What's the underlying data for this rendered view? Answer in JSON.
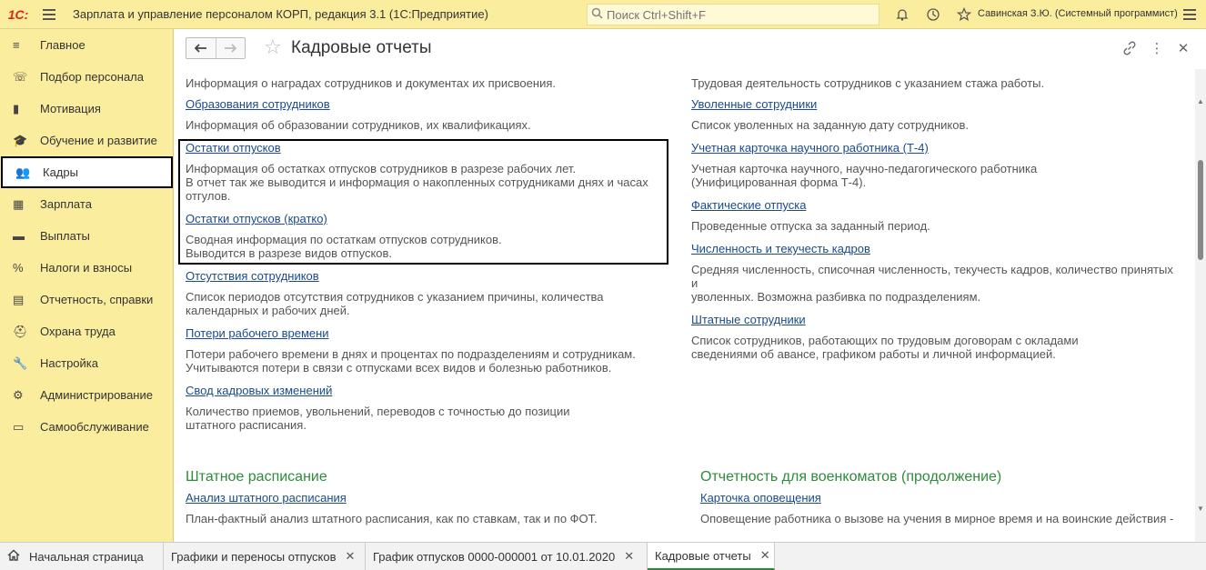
{
  "app": {
    "logo_text": "1С:",
    "title": "Зарплата и управление персоналом КОРП, редакция 3.1  (1С:Предприятие)",
    "search_placeholder": "Поиск Ctrl+Shift+F",
    "user": "Савинская З.Ю. (Системный программист)"
  },
  "sidebar": {
    "items": [
      {
        "label": "Главное",
        "icon": "≡"
      },
      {
        "label": "Подбор персонала",
        "icon": "☏"
      },
      {
        "label": "Мотивация",
        "icon": "▮"
      },
      {
        "label": "Обучение и развитие",
        "icon": "🎓"
      },
      {
        "label": "Кадры",
        "icon": "👥"
      },
      {
        "label": "Зарплата",
        "icon": "▦"
      },
      {
        "label": "Выплаты",
        "icon": "▬"
      },
      {
        "label": "Налоги и взносы",
        "icon": "%"
      },
      {
        "label": "Отчетность, справки",
        "icon": "▤"
      },
      {
        "label": "Охрана труда",
        "icon": "⛑"
      },
      {
        "label": "Настройка",
        "icon": "🔧"
      },
      {
        "label": "Администрирование",
        "icon": "⚙"
      },
      {
        "label": "Самообслуживание",
        "icon": "▭"
      }
    ],
    "active_label": "Кадры"
  },
  "header": {
    "back": "🡐",
    "forward": "🡒",
    "star": "☆",
    "title": "Кадровые отчеты",
    "link_icon": "🔗",
    "more_icon": "⋮",
    "close_icon": "✕"
  },
  "left_column": {
    "top_desc": "Информация о наградах сотрудников и документах их присвоения.",
    "entries": [
      {
        "link": "Образования сотрудников",
        "desc": [
          "Информация об образовании сотрудников, их квалификациях."
        ]
      },
      {
        "link": "Остатки отпусков",
        "desc": [
          "Информация об остатках отпусков сотрудников в разрезе рабочих лет.",
          "В отчет так же выводится и информация о накопленных сотрудниками днях и часах",
          "отгулов."
        ]
      },
      {
        "link": "Остатки отпусков (кратко)",
        "desc": [
          "Сводная информация по остаткам отпусков сотрудников.",
          "Выводится в разрезе видов отпусков."
        ]
      },
      {
        "link": "Отсутствия сотрудников",
        "desc": [
          "Список периодов отсутствия сотрудников с указанием причины, количества",
          "календарных и рабочих дней."
        ]
      },
      {
        "link": "Потери рабочего времени",
        "desc": [
          "Потери рабочего времени в днях и процентах по подразделениям и сотрудникам.",
          "Учитываются потери в связи с отпусками всех видов и болезнью работников."
        ]
      },
      {
        "link": "Свод кадровых изменений",
        "desc": [
          "Количество приемов, увольнений, переводов с точностью до позиции",
          "штатного расписания."
        ]
      }
    ],
    "group_title": "Штатное расписание",
    "group_entry": {
      "link": "Анализ штатного расписания",
      "desc": "План-фактный анализ штатного расписания, как по ставкам, так и по ФОТ."
    }
  },
  "right_column": {
    "top_desc": "Трудовая деятельность сотрудников с указанием стажа работы.",
    "entries": [
      {
        "link": "Уволенные сотрудники",
        "desc": [
          "Список уволенных на заданную дату сотрудников."
        ]
      },
      {
        "link": "Учетная карточка научного работника (Т-4)",
        "desc": [
          "Учетная карточка научного, научно-педагогического работника",
          "(Унифицированная форма Т-4)."
        ]
      },
      {
        "link": "Фактические отпуска",
        "desc": [
          "Проведенные отпуска за заданный период."
        ]
      },
      {
        "link": "Численность и текучесть кадров",
        "desc": [
          "Средняя численность, списочная численность, текучесть кадров, количество принятых",
          "и",
          "уволенных. Возможна разбивка по подразделениям."
        ]
      },
      {
        "link": "Штатные сотрудники",
        "desc": [
          "Список сотрудников, работающих по трудовым договорам с окладами",
          "сведениями об авансе, графиком работы и личной информацией."
        ]
      }
    ],
    "group_title": "Отчетность для военкоматов (продолжение)",
    "group_entry": {
      "link": "Карточка оповещения",
      "desc": "Оповещение работника о вызове на учения в мирное время и на воинские действия -"
    }
  },
  "tabs": [
    {
      "label": "Начальная страница",
      "closable": false,
      "home": true
    },
    {
      "label": "Графики и переносы отпусков",
      "closable": true
    },
    {
      "label": "График отпусков 0000-000001 от 10.01.2020",
      "closable": true
    },
    {
      "label": "Кадровые отчеты",
      "closable": true,
      "active": true
    }
  ],
  "colors": {
    "accent_yellow": "#fbed9e",
    "link": "#1a4a8c",
    "group_green": "#2e8b3a",
    "logo_red": "#d9261c"
  }
}
